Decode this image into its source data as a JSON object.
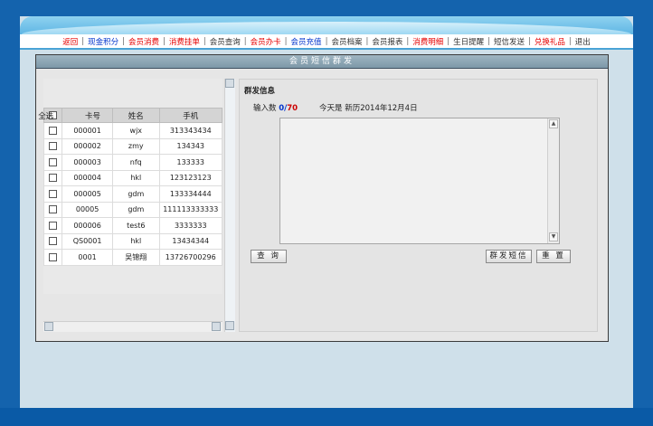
{
  "nav": {
    "items": [
      {
        "label": "返回",
        "color": "red"
      },
      {
        "label": "现金积分",
        "color": "blue"
      },
      {
        "label": "会员消费",
        "color": "red"
      },
      {
        "label": "消费挂单",
        "color": "red"
      },
      {
        "label": "会员查询",
        "color": "black"
      },
      {
        "label": "会员办卡",
        "color": "red"
      },
      {
        "label": "会员充值",
        "color": "blue"
      },
      {
        "label": "会员档案",
        "color": "black"
      },
      {
        "label": "会员报表",
        "color": "black"
      },
      {
        "label": "消费明细",
        "color": "red"
      },
      {
        "label": "生日提醒",
        "color": "black"
      },
      {
        "label": "短信发送",
        "color": "black"
      },
      {
        "label": "兑换礼品",
        "color": "red"
      },
      {
        "label": "退出",
        "color": "black"
      }
    ],
    "separator": "|"
  },
  "panel": {
    "title": "会员短信群发"
  },
  "table": {
    "headers": {
      "select_all": "全选",
      "card": "卡号",
      "name": "姓名",
      "phone": "手机"
    },
    "rows": [
      {
        "card": "000001",
        "name": "wjx",
        "phone": "313343434"
      },
      {
        "card": "000002",
        "name": "zmy",
        "phone": "134343"
      },
      {
        "card": "000003",
        "name": "nfq",
        "phone": "133333"
      },
      {
        "card": "000004",
        "name": "hkl",
        "phone": "123123123"
      },
      {
        "card": "000005",
        "name": "gdm",
        "phone": "133334444"
      },
      {
        "card": "00005",
        "name": "gdm",
        "phone": "111113333333"
      },
      {
        "card": "000006",
        "name": "test6",
        "phone": "3333333"
      },
      {
        "card": "QS0001",
        "name": "hkl",
        "phone": "13434344"
      },
      {
        "card": "0001",
        "name": "吴锦翔",
        "phone": "13726700296"
      }
    ]
  },
  "compose": {
    "section_title": "群发信息",
    "count_label": "输入数",
    "count_current": "0",
    "count_sep": "/",
    "count_max": "70",
    "today_label": "今天是",
    "today_value": "新历2014年12月4日",
    "message": ""
  },
  "buttons": {
    "query": "查 询",
    "send": "群发短信",
    "reset": "重 置"
  },
  "colors": {
    "red": "#e60000",
    "blue": "#0033cc",
    "black": "#333333",
    "frame": "#1463ad"
  }
}
